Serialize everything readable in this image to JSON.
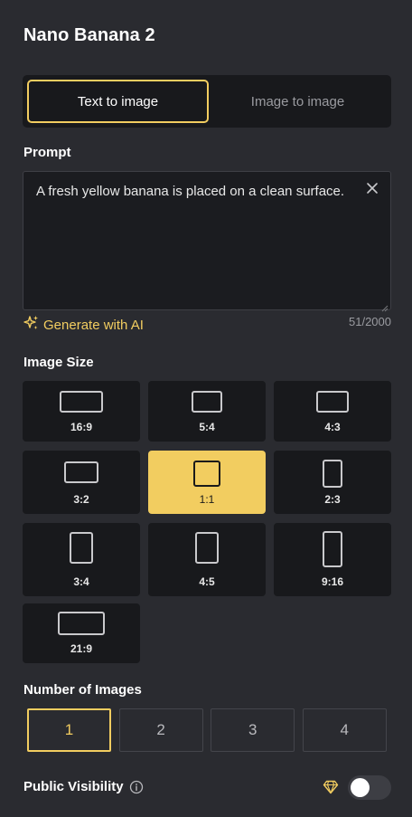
{
  "panel": {
    "title": "Nano Banana 2"
  },
  "mode_tabs": [
    {
      "label": "Text to image",
      "active": true
    },
    {
      "label": "Image to image",
      "active": false
    }
  ],
  "prompt": {
    "label": "Prompt",
    "value": "A fresh yellow banana is placed on a clean surface.",
    "char_count": "51/2000",
    "generate_label": "Generate with AI"
  },
  "image_size": {
    "label": "Image Size",
    "options": [
      {
        "ratio": "16:9",
        "selected": false
      },
      {
        "ratio": "5:4",
        "selected": false
      },
      {
        "ratio": "4:3",
        "selected": false
      },
      {
        "ratio": "3:2",
        "selected": false
      },
      {
        "ratio": "1:1",
        "selected": true
      },
      {
        "ratio": "2:3",
        "selected": false
      },
      {
        "ratio": "3:4",
        "selected": false
      },
      {
        "ratio": "4:5",
        "selected": false
      },
      {
        "ratio": "9:16",
        "selected": false
      },
      {
        "ratio": "21:9",
        "selected": false
      }
    ]
  },
  "number_of_images": {
    "label": "Number of Images",
    "options": [
      "1",
      "2",
      "3",
      "4"
    ],
    "selected": "1"
  },
  "visibility": {
    "label": "Public Visibility",
    "enabled": false
  },
  "colors": {
    "accent": "#f2cd60",
    "background": "#2a2b30",
    "card": "#18191c"
  },
  "icons": {
    "clear": "close-icon",
    "generate": "sparkle-icon",
    "info": "info-icon",
    "premium": "diamond-icon"
  }
}
